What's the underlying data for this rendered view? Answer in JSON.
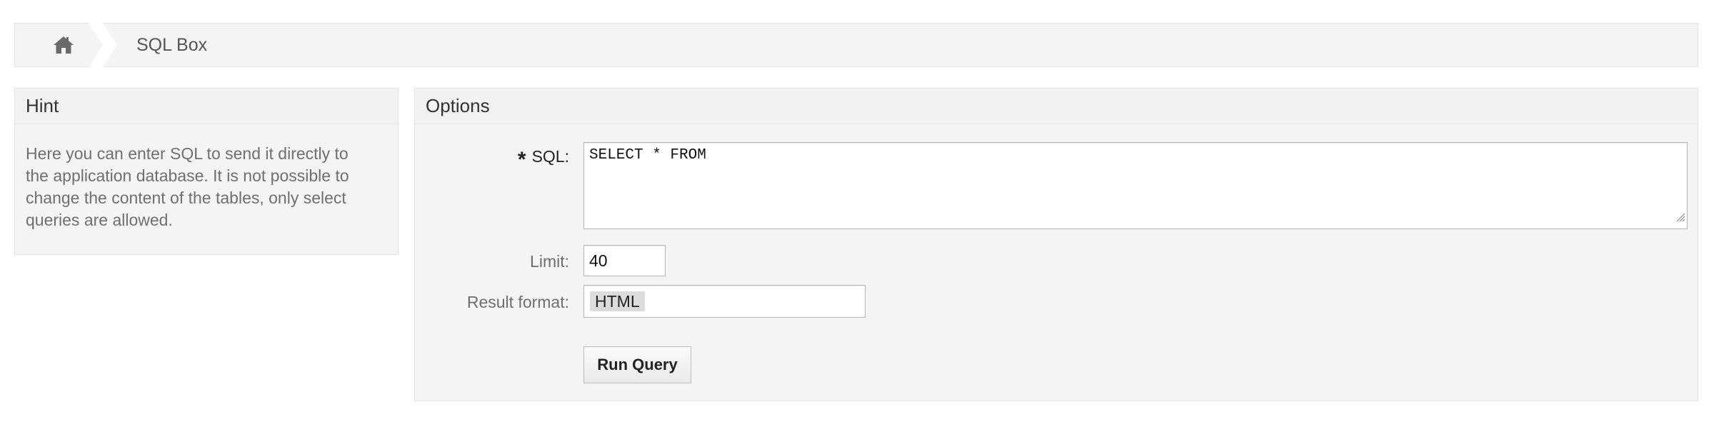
{
  "breadcrumb": {
    "home_icon": "home-icon",
    "current": "SQL Box"
  },
  "hint": {
    "title": "Hint",
    "lines": [
      "Here you can enter SQL to send it directly to",
      "the application database. It is not possible to",
      "change the content of the tables, only select",
      "queries are allowed."
    ]
  },
  "options": {
    "title": "Options",
    "sql": {
      "required_mark": "*",
      "label": "SQL:",
      "value": "SELECT * FROM"
    },
    "limit": {
      "label": "Limit:",
      "value": "40"
    },
    "result_format": {
      "label": "Result format:",
      "value": "HTML"
    },
    "run_button_label": "Run Query"
  }
}
